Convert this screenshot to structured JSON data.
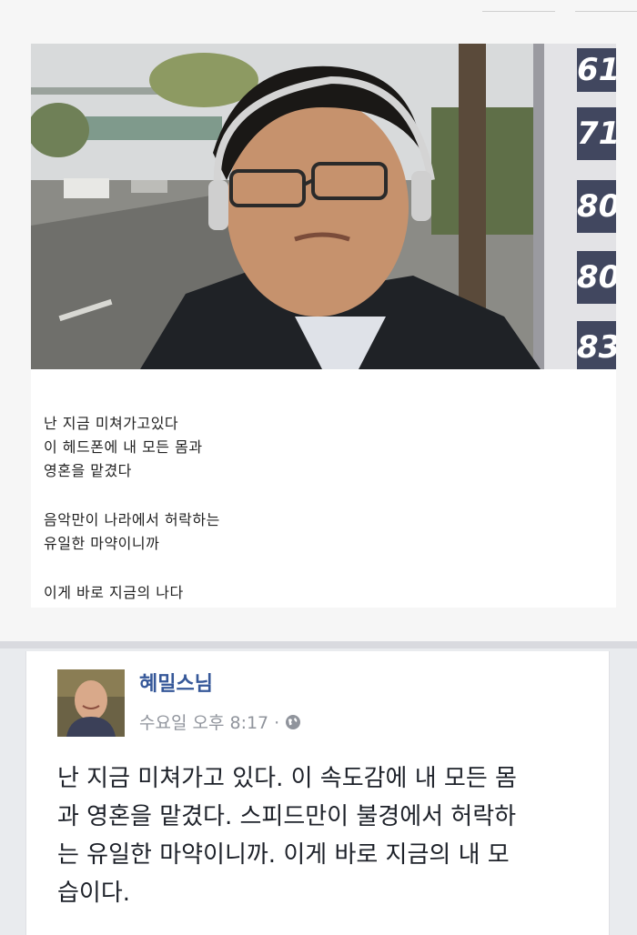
{
  "top_post": {
    "caption_lines": [
      "난 지금 미쳐가고있다",
      "이 헤드폰에 내 모든 몸과",
      "영혼을 맡겼다",
      "",
      "음악만이 나라에서 허락하는",
      "유일한 마약이니까",
      "",
      "이게 바로 지금의 나다"
    ],
    "sign_numbers": [
      "61",
      "71",
      "80",
      "80",
      "83"
    ]
  },
  "bottom_post": {
    "author": "혜밀스님",
    "timestamp": "수요일 오후 8:17 ·",
    "privacy_icon": "globe-icon",
    "text_lines": [
      "난 지금 미쳐가고 있다. 이 속도감에 내 모든 몸",
      "과 영혼을 맡겼다. 스피드만이 불경에서 허락하",
      "는 유일한 마약이니까. 이게 바로 지금의 내 모",
      "습이다."
    ]
  },
  "colors": {
    "author_link": "#365899",
    "meta_gray": "#90949c",
    "body_text": "#1d2129"
  }
}
